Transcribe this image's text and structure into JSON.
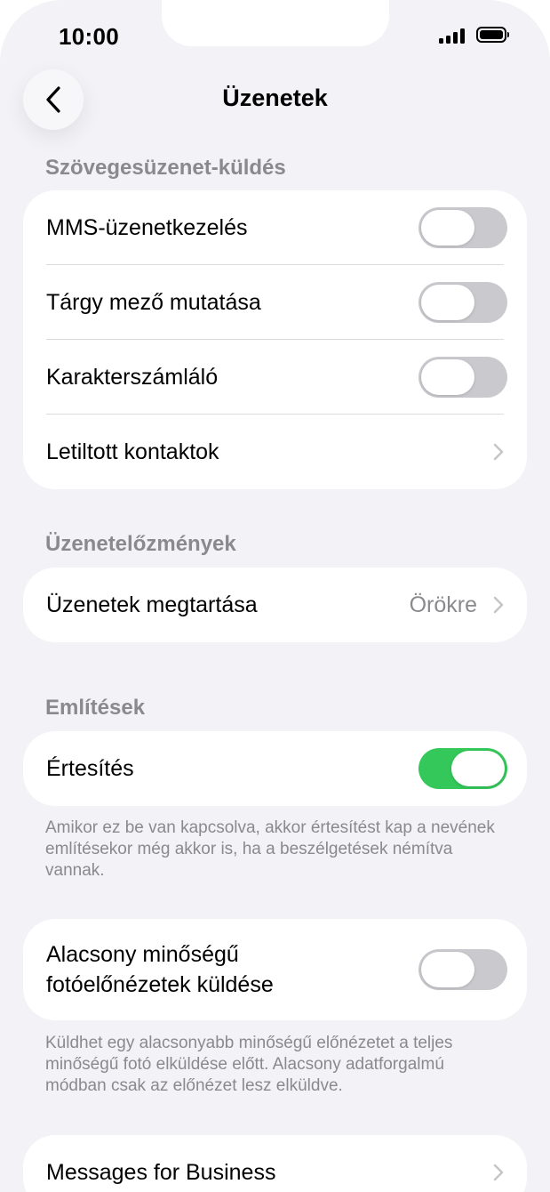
{
  "status_bar": {
    "time": "10:00"
  },
  "nav": {
    "title": "Üzenetek",
    "back_icon": "chevron-left-icon"
  },
  "sections": {
    "texting": {
      "header": "Szövegesüzenet-küldés",
      "rows": {
        "mms": {
          "label": "MMS-üzenetkezelés",
          "on": false
        },
        "subject": {
          "label": "Tárgy mező mutatása",
          "on": false
        },
        "char_count": {
          "label": "Karakterszámláló",
          "on": false
        },
        "blocked": {
          "label": "Letiltott kontaktok"
        }
      }
    },
    "history": {
      "header": "Üzenetelőzmények",
      "rows": {
        "keep": {
          "label": "Üzenetek megtartása",
          "value": "Örökre"
        }
      }
    },
    "mentions": {
      "header": "Említések",
      "rows": {
        "notify": {
          "label": "Értesítés",
          "on": true
        }
      },
      "footnote": "Amikor ez be van kapcsolva, akkor értesítést kap a nevének említésekor még akkor is, ha a beszélgetések némítva vannak."
    },
    "low_quality": {
      "rows": {
        "low_quality_photos": {
          "label": "Alacsony minőségű fotóelőnézetek küldése",
          "on": false
        }
      },
      "footnote": "Küldhet egy alacsonyabb minőségű előnézetet a teljes minőségű fotó elküldése előtt. Alacsony adatforgalmú módban csak az előnézet lesz elküldve."
    },
    "business": {
      "rows": {
        "messages_for_business": {
          "label": "Messages for Business"
        }
      }
    }
  },
  "colors": {
    "background": "#f2f2f7",
    "card": "#ffffff",
    "toggle_on": "#34c759",
    "toggle_off": "#c9c9ce",
    "secondary_text": "#8a8a8e"
  }
}
